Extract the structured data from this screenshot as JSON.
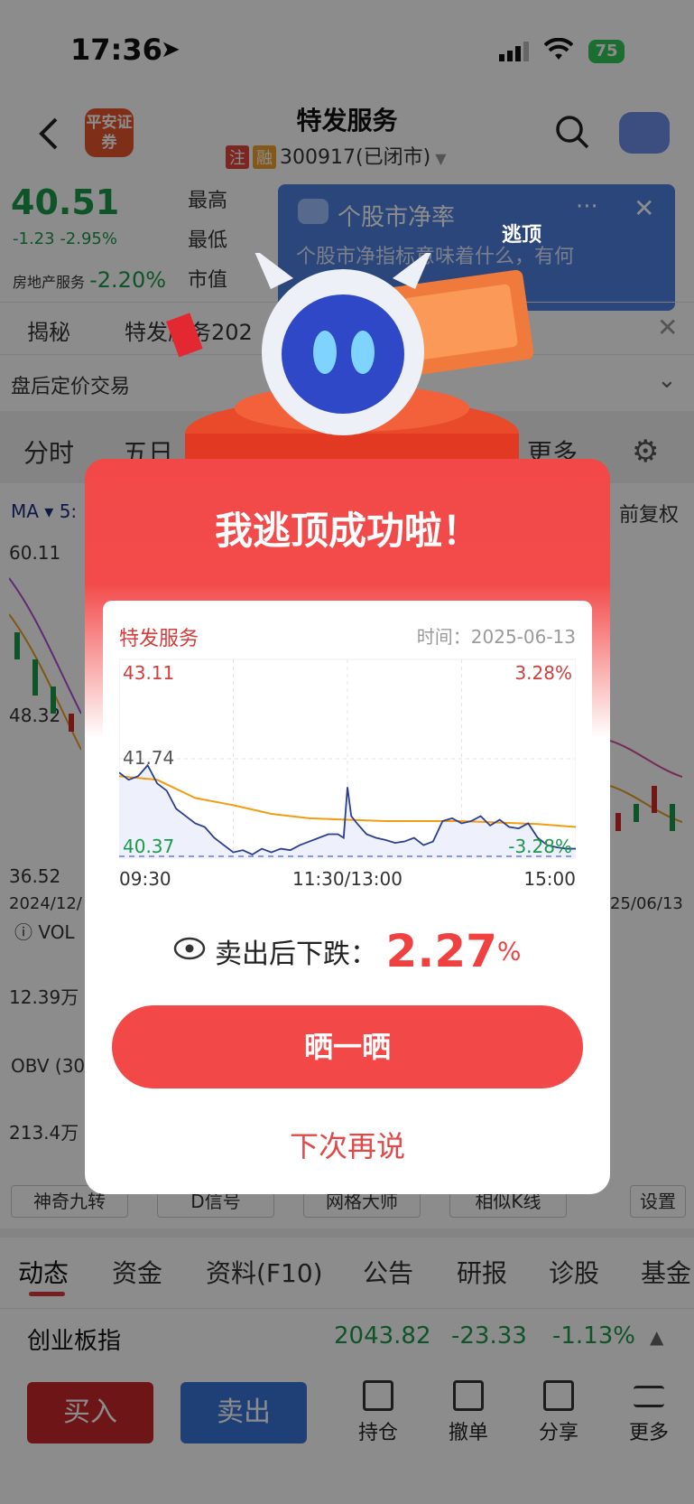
{
  "status": {
    "time": "17:36",
    "battery": "75"
  },
  "header": {
    "title": "特发服务",
    "logo": "平安证券",
    "tag_zhu": "注",
    "tag_rong": "融",
    "code": "300917(已闭市)"
  },
  "quote": {
    "price": "40.51",
    "change": "-1.23",
    "change_pct": "-2.95%",
    "sector_name": "房地产服务",
    "sector_pct": "-2.20%",
    "label_high": "最高",
    "label_low": "最低",
    "label_cap": "市值"
  },
  "banner": {
    "title": "个股市净率",
    "text": "个股市净指标意味着什么，有何",
    "badge": "逃顶"
  },
  "row1": {
    "reveal": "揭秘",
    "news": "特发服务202"
  },
  "row2": {
    "after_hours": "盘后定价交易"
  },
  "chart_tabs": {
    "minute": "分时",
    "five_day": "五日",
    "more": "更多",
    "fq": "前复权"
  },
  "kline": {
    "ma": "MA",
    "ma5": "5:",
    "p1": "60.11",
    "p2": "48.32",
    "p3": "36.52",
    "date_l": "2024/12/",
    "date_r": "25/06/13",
    "vol": "VOL",
    "vol_val": "12.39万",
    "obv": "OBV (30",
    "obv_val": "213.4万"
  },
  "tools": [
    "神奇九转",
    "D信号",
    "网格大师",
    "相似K线",
    "设置"
  ],
  "bottom_tabs": [
    "动态",
    "资金",
    "资料(F10)",
    "公告",
    "研报",
    "诊股",
    "基金"
  ],
  "index": {
    "name": "创业板指",
    "value": "2043.82",
    "change": "-23.33",
    "pct": "-1.13%"
  },
  "trade": {
    "buy": "买入",
    "sell": "卖出"
  },
  "actions": [
    "持仓",
    "撤单",
    "分享",
    "更多"
  ],
  "popup": {
    "title": "我逃顶成功啦！",
    "stock": "特发服务",
    "time_label": "时间：",
    "date": "2025-06-13",
    "result_label": "卖出后下跌：",
    "result_value": "2.27",
    "result_unit": "%",
    "share": "晒一晒",
    "later": "下次再说"
  },
  "chart_data": {
    "type": "line",
    "title": "特发服务",
    "x_ticks": [
      "09:30",
      "11:30/13:00",
      "15:00"
    ],
    "y_left_ticks": [
      "43.11",
      "41.74",
      "40.37"
    ],
    "y_right_ticks": [
      "3.28%",
      "-3.28%"
    ],
    "ylim": [
      40.37,
      43.11
    ],
    "prev_close": 41.74,
    "series": [
      {
        "name": "price",
        "color": "#2a3f8f",
        "x": [
          0,
          5,
          10,
          15,
          20,
          25,
          30,
          35,
          40,
          45,
          50,
          55,
          60,
          65,
          70,
          75,
          80,
          85,
          90,
          95,
          100,
          105,
          110,
          115,
          118,
          120,
          122,
          125,
          130,
          135,
          140,
          145,
          150,
          155,
          160,
          165,
          170,
          175,
          180,
          185,
          190,
          195,
          200,
          205,
          210,
          215,
          220,
          225,
          230,
          235,
          240
        ],
        "values": [
          41.55,
          41.45,
          41.5,
          41.65,
          41.4,
          41.3,
          41.05,
          40.95,
          40.85,
          40.8,
          40.65,
          40.55,
          40.45,
          40.48,
          40.42,
          40.5,
          40.45,
          40.5,
          40.48,
          40.55,
          40.6,
          40.65,
          40.7,
          40.7,
          40.65,
          41.35,
          40.95,
          40.85,
          40.7,
          40.65,
          40.62,
          40.58,
          40.6,
          40.65,
          40.55,
          40.6,
          40.88,
          40.92,
          40.85,
          40.88,
          40.95,
          40.82,
          40.9,
          40.8,
          40.78,
          40.85,
          40.65,
          40.55,
          40.52,
          40.5,
          40.5
        ]
      },
      {
        "name": "avg",
        "color": "#f39c12",
        "x": [
          0,
          20,
          40,
          60,
          80,
          100,
          120,
          140,
          160,
          180,
          200,
          220,
          240
        ],
        "values": [
          41.5,
          41.45,
          41.2,
          41.1,
          40.98,
          40.92,
          40.9,
          40.88,
          40.88,
          40.88,
          40.86,
          40.84,
          40.8
        ]
      }
    ]
  }
}
